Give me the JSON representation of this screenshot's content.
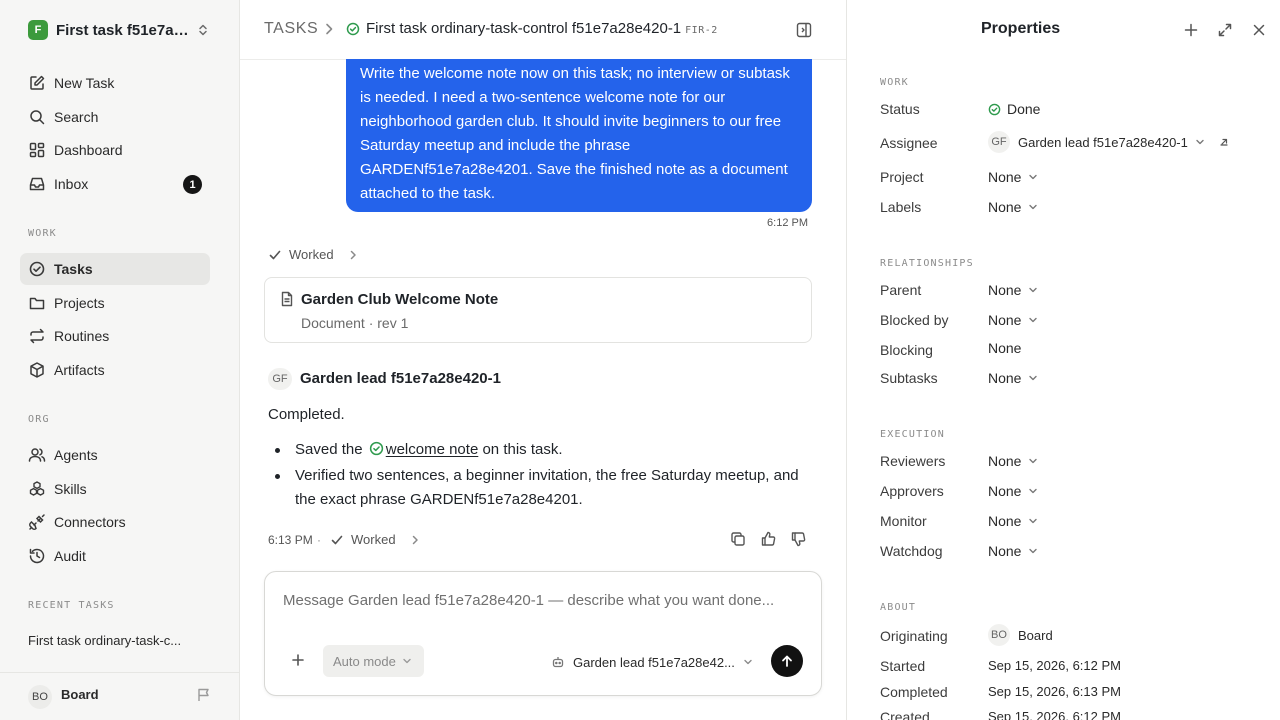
{
  "workspace": {
    "logo": "F",
    "name": "First task f51e7a2..."
  },
  "nav": {
    "new_task": "New Task",
    "search": "Search",
    "dashboard": "Dashboard",
    "inbox": "Inbox",
    "inbox_count": "1",
    "work_label": "WORK",
    "tasks": "Tasks",
    "projects": "Projects",
    "routines": "Routines",
    "artifacts": "Artifacts",
    "org_label": "ORG",
    "agents": "Agents",
    "skills": "Skills",
    "connectors": "Connectors",
    "audit": "Audit",
    "recent_label": "RECENT TASKS",
    "recent_task": "First task ordinary-task-c..."
  },
  "user": {
    "initials": "BO",
    "name": "Board"
  },
  "header": {
    "section": "TASKS",
    "task_title": "First task ordinary-task-control f51e7a28e420-1",
    "task_id": "FIR-2"
  },
  "conversation": {
    "user_message": "Write the welcome note now on this task; no interview or subtask is needed. I need a two-sentence welcome note for our neighborhood garden club. It should invite beginners to our free Saturday meetup and include the phrase GARDENf51e7a28e4201. Save the finished note as a document attached to the task.",
    "user_time": "6:12 PM",
    "worked_label_1": "Worked",
    "document": {
      "title": "Garden Club Welcome Note",
      "meta": "Document · rev 1"
    },
    "agent": {
      "initials": "GF",
      "name": "Garden lead f51e7a28e420-1",
      "status_line": "Completed.",
      "bullet1_pre": "Saved the",
      "bullet1_link": "welcome note",
      "bullet1_post": "on this task.",
      "bullet2": "Verified two sentences, a beginner invitation, the free Saturday meetup, and the exact phrase GARDENf51e7a28e4201.",
      "time": "6:13 PM",
      "sep": "·",
      "worked_label": "Worked"
    }
  },
  "composer": {
    "placeholder": "Message Garden lead f51e7a28e420-1 — describe what you want done...",
    "mode": "Auto mode",
    "agent": "Garden lead f51e7a28e42..."
  },
  "properties": {
    "title": "Properties",
    "work_section": "WORK",
    "status_label": "Status",
    "status_value": "Done",
    "assignee_label": "Assignee",
    "assignee_initials": "GF",
    "assignee_value": "Garden lead f51e7a28e420-1",
    "project_label": "Project",
    "project_value": "None",
    "labels_label": "Labels",
    "labels_value": "None",
    "relationships_section": "RELATIONSHIPS",
    "parent_label": "Parent",
    "parent_value": "None",
    "blocked_by_label": "Blocked by",
    "blocked_by_value": "None",
    "blocking_label": "Blocking",
    "blocking_value": "None",
    "subtasks_label": "Subtasks",
    "subtasks_value": "None",
    "execution_section": "EXECUTION",
    "reviewers_label": "Reviewers",
    "reviewers_value": "None",
    "approvers_label": "Approvers",
    "approvers_value": "None",
    "monitor_label": "Monitor",
    "monitor_value": "None",
    "watchdog_label": "Watchdog",
    "watchdog_value": "None",
    "about_section": "ABOUT",
    "originating_label": "Originating",
    "originating_initials": "BO",
    "originating_value": "Board",
    "started_label": "Started",
    "started_value": "Sep 15, 2026, 6:12 PM",
    "completed_label": "Completed",
    "completed_value": "Sep 15, 2026, 6:13 PM",
    "created_label": "Created",
    "created_value": "Sep 15, 2026, 6:12 PM"
  },
  "colors": {
    "accent_blue": "#2463eb",
    "done_green": "#2e9a4d",
    "brand_green": "#3c9a3c"
  }
}
